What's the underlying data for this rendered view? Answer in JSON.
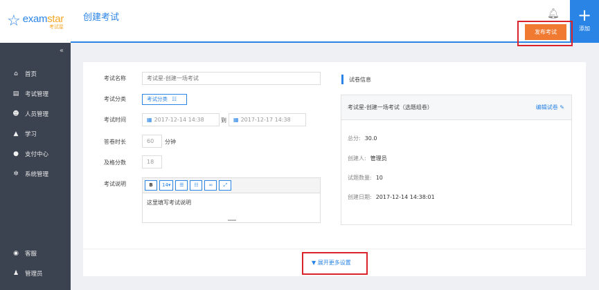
{
  "logo": {
    "main_prefix": "exam",
    "main_suffix": "star",
    "sub": "考试星"
  },
  "header": {
    "title": "创建考试",
    "add_label": "添加",
    "publish_label": "发布考试"
  },
  "sidebar": {
    "items": [
      {
        "icon": "home-icon",
        "glyph": "⌂",
        "label": "首页"
      },
      {
        "icon": "exam-manage-icon",
        "glyph": "▤",
        "label": "考试管理"
      },
      {
        "icon": "users-icon",
        "glyph": "☻",
        "label": "人员管理"
      },
      {
        "icon": "graduation-cap-icon",
        "glyph": "▲",
        "label": "学习"
      },
      {
        "icon": "payment-icon",
        "glyph": "●",
        "label": "支付中心"
      },
      {
        "icon": "settings-icon",
        "glyph": "✲",
        "label": "系统管理"
      }
    ],
    "bottom": [
      {
        "icon": "support-icon",
        "glyph": "◉",
        "label": "客服"
      },
      {
        "icon": "admin-user-icon",
        "glyph": "♟",
        "label": "管理员"
      }
    ]
  },
  "form": {
    "name_label": "考试名称",
    "name_placeholder": "考试星-创建一场考试",
    "category_label": "考试分类",
    "category_button": "考试分类",
    "time_label": "考试时间",
    "start_time": "2017-12-14 14:38",
    "to_label": "到",
    "end_time": "2017-12-17 14:38",
    "duration_label": "答卷时长",
    "duration_value": "60",
    "duration_unit": "分钟",
    "pass_label": "及格分数",
    "pass_value": "18",
    "desc_label": "考试说明",
    "desc_text": "这里填写考试说明",
    "toolbar": {
      "bold": "B",
      "font_size": "14▾",
      "list_ul": "☰",
      "list_ol": "☷",
      "link": "∞",
      "fullscreen": "⤢"
    }
  },
  "paper": {
    "section_title": "试卷信息",
    "name": "考试星-创建一场考试（选题组卷）",
    "edit_label": "编辑试卷 ✎",
    "total_label": "总分:",
    "total_value": "30.0",
    "creator_label": "创建人:",
    "creator_value": "管理员",
    "count_label": "试题数量:",
    "count_value": "10",
    "date_label": "创建日期:",
    "date_value": "2017-12-14 14:38:01"
  },
  "more_settings": "▼ 展开更多设置",
  "colors": {
    "accent": "#2a84e6",
    "publish": "#f07a32",
    "highlight": "#d9222a",
    "sidebar": "#3b4250"
  }
}
